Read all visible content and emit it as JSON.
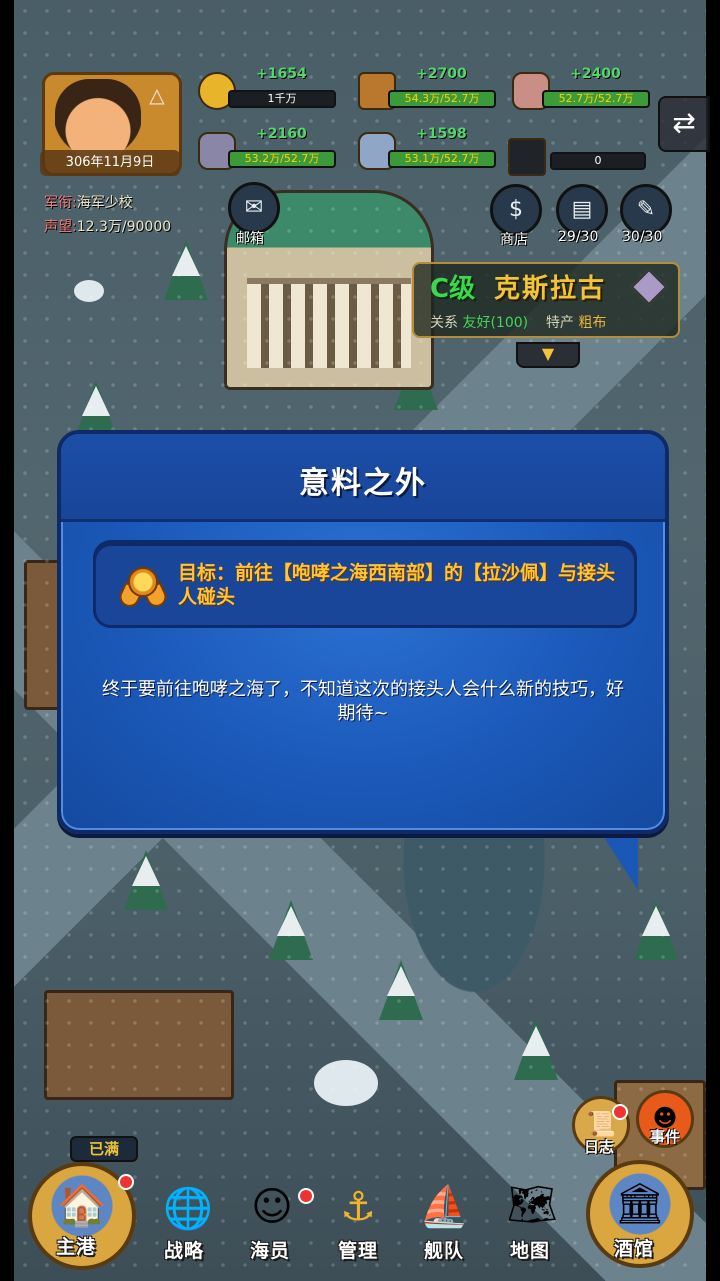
{
  "hud": {
    "date": "306年11月9日",
    "rank_key": "军衔:",
    "rank_value": "海军少校",
    "fame_key": "声望:",
    "fame_value": "12.3万/90000"
  },
  "resources": [
    {
      "name": "gold-coin",
      "gain": "+1654",
      "value": "1千万",
      "color": "#e8b52a"
    },
    {
      "name": "wood",
      "gain": "+2700",
      "value": "54.3万/52.7万",
      "color": "#b9782e"
    },
    {
      "name": "stone",
      "gain": "+2400",
      "value": "52.7万/52.7万",
      "color": "#c98f86"
    },
    {
      "name": "iron",
      "gain": "+2160",
      "value": "53.2万/52.7万",
      "color": "#8a86a8"
    },
    {
      "name": "crystal",
      "gain": "+1598",
      "value": "53.1万/52.7万",
      "color": "#8fa6c6"
    },
    {
      "name": "scholar-cap",
      "gain": "",
      "value": "0",
      "color": "#202428"
    }
  ],
  "top_buttons": {
    "mail": "邮箱",
    "shop": "商店",
    "book": "29/30",
    "scroll": "30/30"
  },
  "city": {
    "grade": "C级",
    "name": "克斯拉古",
    "relation_key": "关系",
    "relation_value": "友好(100)",
    "specialty_key": "特产",
    "specialty_value": "粗布"
  },
  "dialog": {
    "title": "意料之外",
    "goal": "目标：前往【咆哮之海西南部】的【拉沙佩】与接头人碰头",
    "body": "终于要前往咆哮之海了，不知道这次的接头人会什么新的技巧，好期待~"
  },
  "side": {
    "log": "日志",
    "event": "事件"
  },
  "nav": {
    "full_tag": "已满",
    "home": "主港",
    "strategy": "战略",
    "crew": "海员",
    "manage": "管理",
    "fleet": "舰队",
    "map": "地图",
    "tavern": "酒馆"
  },
  "colors": {
    "dialog_bg": "#1a57b6",
    "goal_text": "#ffc533",
    "gain_text": "#53d66a",
    "grade_text": "#3bd84f",
    "city_name": "#f0c53a"
  }
}
